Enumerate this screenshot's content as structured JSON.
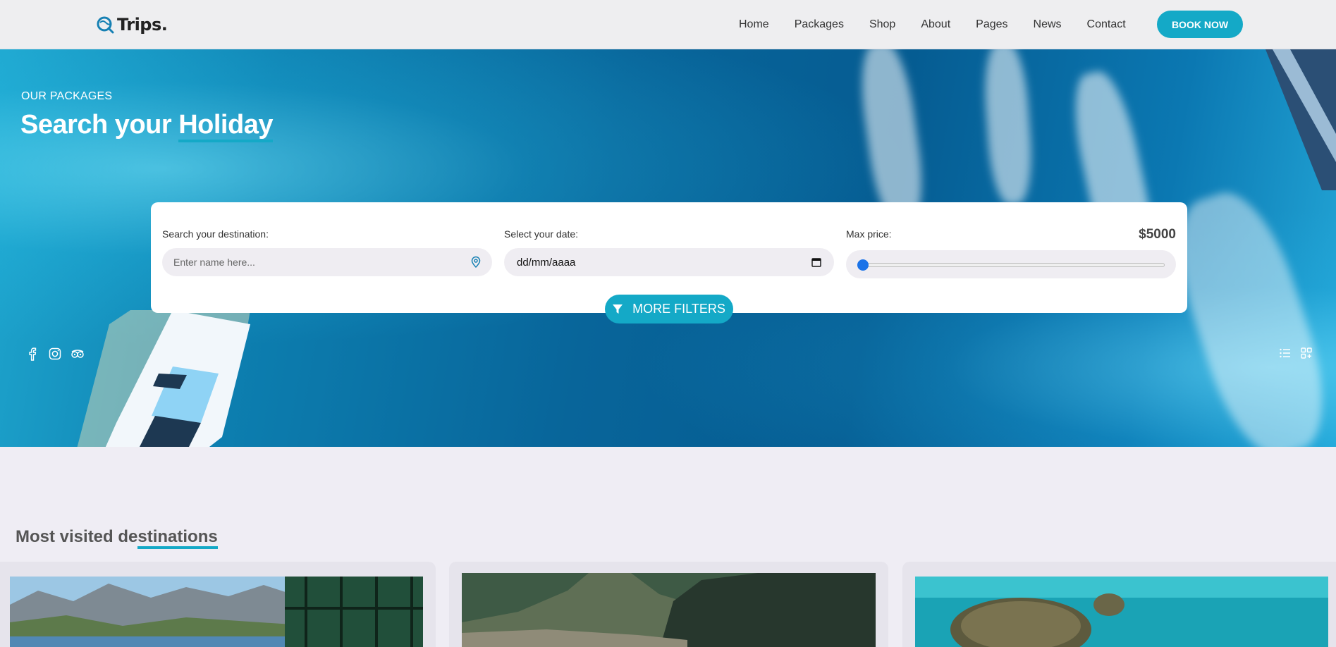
{
  "header": {
    "logo_text": "Trips.",
    "logo_icon": "search-globe-icon",
    "nav": [
      "Home",
      "Packages",
      "Shop",
      "About",
      "Pages",
      "News",
      "Contact"
    ],
    "cta_label": "BOOK NOW",
    "accent_color": "#14a9c7"
  },
  "hero": {
    "eyebrow": "OUR PACKAGES",
    "title_plain": "Search your ",
    "title_highlight": "Holiday"
  },
  "search": {
    "destination_label": "Search your destination:",
    "destination_placeholder": "Enter name here...",
    "date_label": "Select your date:",
    "date_value": "dd/mm/aaaa",
    "price_label": "Max price:",
    "price_value": "$5000",
    "price_slider_fraction": 0.0,
    "filters_label": "MORE FILTERS"
  },
  "social": [
    "facebook-icon",
    "instagram-icon",
    "tripadvisor-icon"
  ],
  "view_toggles": [
    "list-view-icon",
    "grid-view-icon"
  ],
  "destinations": {
    "title_plain": "Most visited de",
    "title_highlight": "stinations"
  }
}
